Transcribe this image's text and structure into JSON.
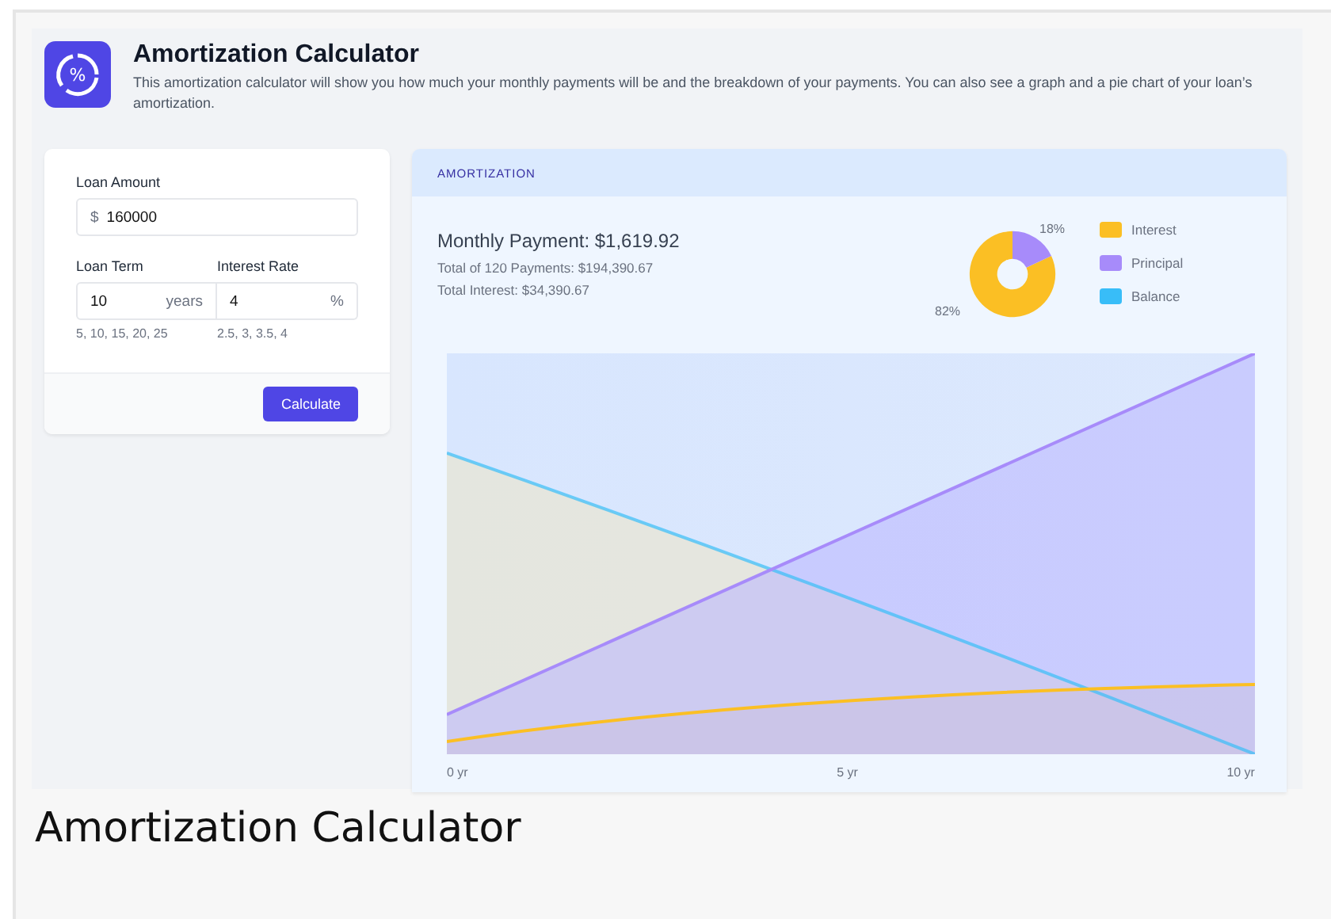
{
  "header": {
    "logo_symbol": "%",
    "title": "Amortization Calculator",
    "description": "This amortization calculator will show you how much your monthly payments will be and the breakdown of your payments. You can also see a graph and a pie chart of your loan’s amortization."
  },
  "form": {
    "loan_amount": {
      "label": "Loan Amount",
      "prefix": "$",
      "value": "160000"
    },
    "loan_term": {
      "label": "Loan Term",
      "value": "10",
      "suffix": "years",
      "hint": "5, 10, 15, 20, 25"
    },
    "interest_rate": {
      "label": "Interest Rate",
      "value": "4",
      "suffix": "%",
      "hint": "2.5, 3, 3.5, 4"
    },
    "button": "Calculate"
  },
  "results": {
    "heading": "AMORTIZATION",
    "monthly_payment": "Monthly Payment: $1,619.92",
    "total_payments": "Total of 120 Payments: $194,390.67",
    "total_interest": "Total Interest: $34,390.67",
    "chart_data": {
      "type": "donut",
      "categories": [
        "Interest",
        "Principal"
      ],
      "values": [
        82,
        18
      ],
      "colors": [
        "#fbbf24",
        "#a78bfa"
      ],
      "value_labels": [
        "82%",
        "18%"
      ]
    },
    "graph_legend": {
      "label": "Balance",
      "color": "#38bdf8"
    },
    "graph_x_labels": [
      "0 yr",
      "5 yr",
      "10 yr"
    ]
  },
  "caption": "Amortization Calculator"
}
